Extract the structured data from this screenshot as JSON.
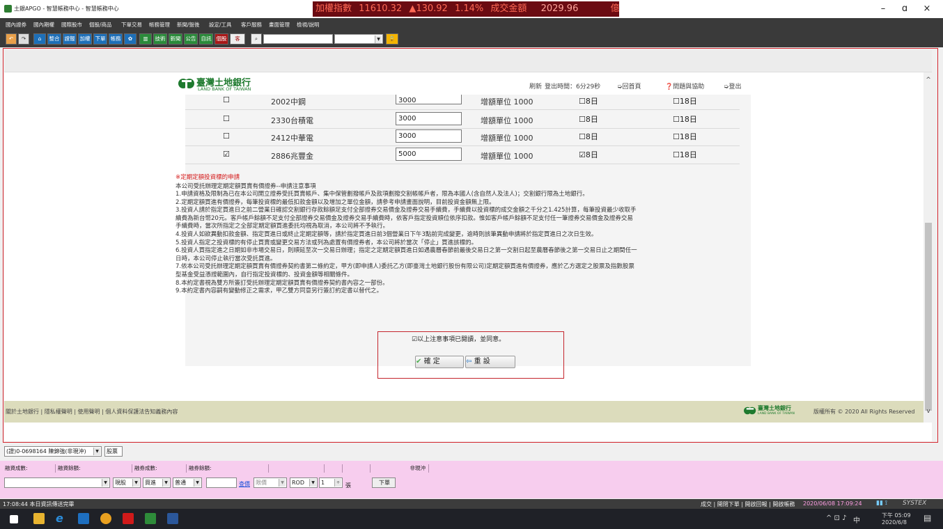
{
  "window": {
    "title": "土銀APGO - 智慧帳務中心 - 智慧帳務中心",
    "minimize": "–",
    "restore": "ɑ",
    "close": "×"
  },
  "ticker": {
    "index_label": "加權指數",
    "index_value": "11610.32",
    "change": "▲130.92",
    "change_pct": "1.14%",
    "volume_label": "成交金額",
    "volume_value": "2029.96",
    "unit": "億"
  },
  "menu": [
    "國內證券",
    "國內期權",
    "國際股市",
    "個股/商品",
    "下單交易",
    "帳務管理",
    "新聞/盤後",
    "設定/工具",
    "客戶服務",
    "畫面管理",
    "檢視/說明"
  ],
  "toolbar": {
    "items": [
      "整合",
      "證報",
      "加權",
      "下單",
      "帳務",
      "技術",
      "新聞",
      "公告",
      "自訊",
      "個股",
      "客"
    ]
  },
  "bank": {
    "name_cn": "臺灣土地銀行",
    "name_en": "LAND BANK OF TAIWAN"
  },
  "header_links": {
    "refresh": "刷新",
    "login_time_label": "登出時間：6分29秒",
    "home": "回首頁",
    "help": "問題與協助",
    "logout": "登出"
  },
  "icons": {
    "home": "home-icon",
    "help": "help-icon",
    "logout": "logout-icon"
  },
  "stocks": [
    {
      "name": "2002中鋼",
      "amount": "3000",
      "unit": "增額單位 1000",
      "checked": "☐",
      "day8": "☐8日",
      "day18": "☐18日"
    },
    {
      "name": "2330台積電",
      "amount": "3000",
      "unit": "增額單位 1000",
      "checked": "☐",
      "day8": "☐8日",
      "day18": "☐18日"
    },
    {
      "name": "2412中華電",
      "amount": "3000",
      "unit": "增額單位 1000",
      "checked": "☐",
      "day8": "☐8日",
      "day18": "☐18日"
    },
    {
      "name": "2886兆豐金",
      "amount": "5000",
      "unit": "增額單位 1000",
      "checked": "☑",
      "day8": "☑8日",
      "day18": "☐18日"
    }
  ],
  "notes": {
    "title": "※定期定額投資標的申請",
    "subtitle": "本公司受託辦理定期定額買賣有價證券--申請注意事項",
    "lines": [
      "1.申請資格及限制為已在本公司開立證券受託買賣帳戶、集中保管劃撥帳戶及款項劃撥交割帳帳戶者，限為本國人(含自然人及法人)；交割銀行限為土地銀行。",
      "2.定期定額買進有價證券，每筆投資標的最低扣款金額以及增加之單位金額，請參考申請畫面說明，目前投資金額無上限。",
      "3.投資人請於指定買進日之前二營業日確認交割銀行存款餘額足支付全部證券交易價金及證券交易手續費，手續費以投資標的成交金額之千分之1.425計算，每筆投資最少收取手",
      "續費為新台幣20元。客戶帳戶餘額不足支付全部證券交易價金及證券交易手續費時，依客戶指定投資順位依序扣款。惟如客戶帳戶餘額不足支付任一筆證券交易價金及證券交易",
      "手續費時，當次所指定之全部定期定額買進委託均視為取消，本公司將不予執行。",
      "4.投資人如欲異動扣款金額、指定買進日或終止定期定額等，請於指定買進日前3個營業日下午3點前完成變更，逾時則該筆異動申請將於指定買進日之次日生效。",
      "5.投資人指定之投資標的有停止買賣或變更交易方法或列為處置有價證券者，本公司將於當次「停止」買進該標的。",
      "6.投資人買指定進之日期如非市場交易日，則順延至次一交易日辦理；指定之定期定額買進日如遇農曆春節前最後交易日之第一交割日起至農曆春節後之第一交易日止之期間任一",
      "日時，本公司停止執行當次受託買進。",
      "7.依本公司受託辦理定期定額買賣有價證券契約書第二條約定，甲方(即申請人)委託乙方(即臺灣土地銀行股份有限公司)定期定額買進有價證券，應於乙方選定之股票及指數股票",
      "型基金受益憑證範圍內，自行指定投資標的、投資金額等相關條件。",
      "8.本約定書視為雙方所簽訂受託辦理定期定額買賣有價證券契約書內容之一部份。",
      "9.本約定書內容嗣有變動修正之需求，甲乙雙方同意另行簽訂約定書以替代之。"
    ]
  },
  "agree": {
    "label": "☑以上注意事項已閱讀，並同意。",
    "confirm": "確 定",
    "reset": "重 設"
  },
  "footer": {
    "links": "關於土地銀行 | 隱私權聲明 | 使用聲明 | 個人資料保護法告知義務內容",
    "copyright": "版權所有 © 2020 All Rights Reserved"
  },
  "account": {
    "value": "(證)0-0698164 陳錦強(非現沖)",
    "tab": "股票"
  },
  "summary": {
    "cols": [
      "融資成數:",
      "融資餘額:",
      "融券成數:",
      "融券餘額:",
      "非現沖"
    ]
  },
  "order": {
    "stock_type": "現股",
    "side": "買進",
    "kind": "普通",
    "query": "查價",
    "price_type": "限價",
    "tif": "ROD",
    "qty": "1",
    "qty_unit": "張",
    "submit": "下單"
  },
  "status": {
    "left": "17:08:44 本日資訊傳送完畢",
    "right_tabs": "成交 | 開閉下單 | 開啟回報 | 開啟帳務",
    "datetime": "2020/06/08 17:09:24",
    "brand": "SYSTEX"
  },
  "tray": {
    "time": "下午 05:09",
    "date": "2020/6/8",
    "ime": "中"
  }
}
